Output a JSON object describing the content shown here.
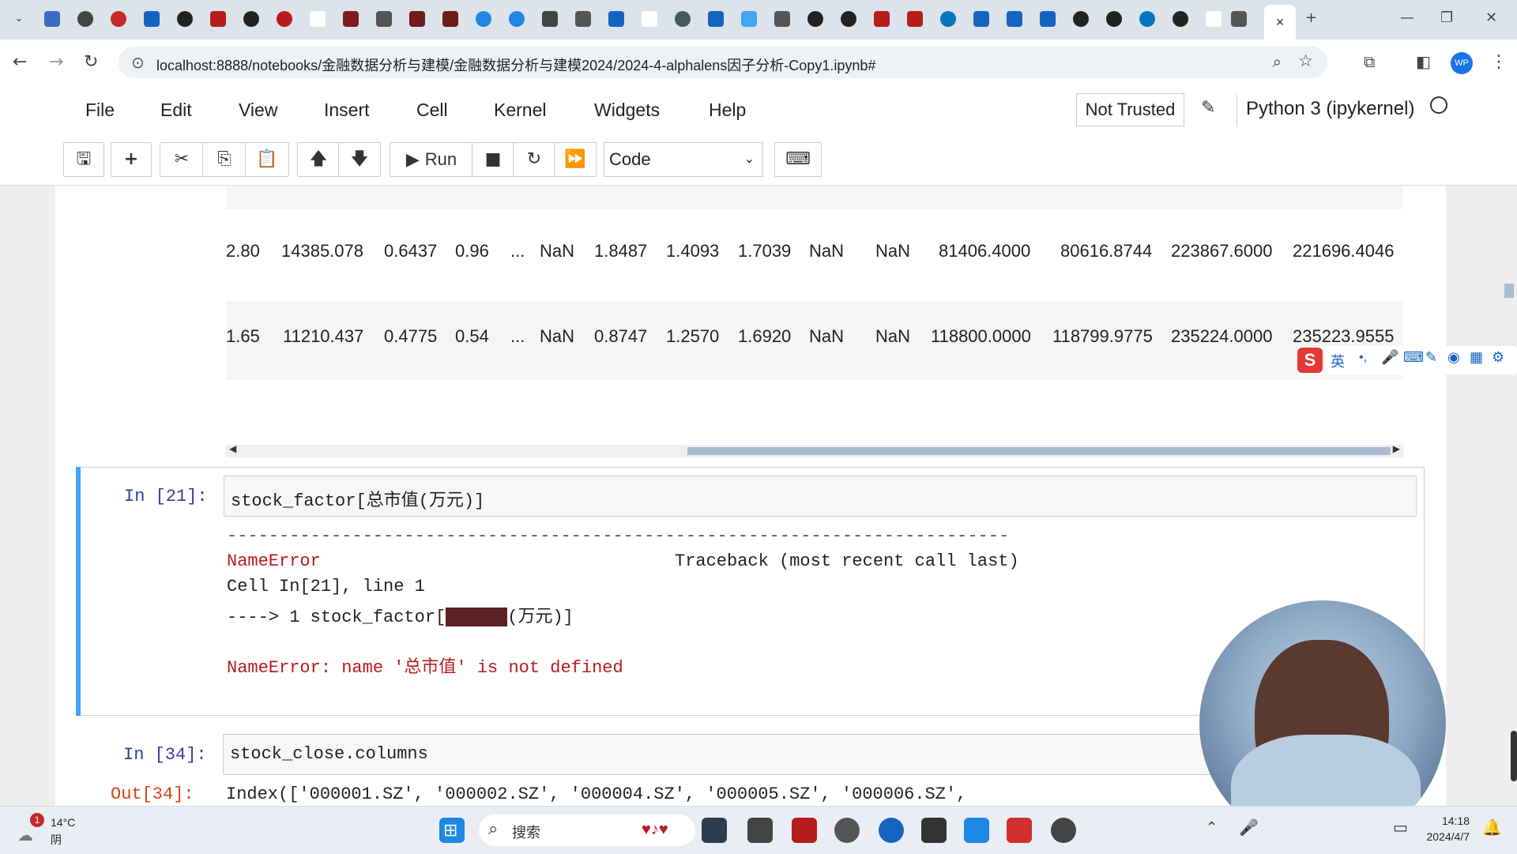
{
  "browser": {
    "url": "localhost:8888/notebooks/金融数据分析与建模/金融数据分析与建模2024/2024-4-alphalens因子分析-Copy1.ipynb#",
    "tab_close": "×",
    "new_tab": "+",
    "profile": "WP"
  },
  "menu": {
    "items": [
      "File",
      "Edit",
      "View",
      "Insert",
      "Cell",
      "Kernel",
      "Widgets",
      "Help"
    ],
    "trust": "Not Trusted",
    "kernel": "Python 3 (ipykernel)"
  },
  "toolbar": {
    "run_label": "Run",
    "cell_type": "Code"
  },
  "dataframe": {
    "rows": [
      [
        "2.80",
        "14385.078",
        "0.6437",
        "0.96",
        "...",
        "NaN",
        "1.8487",
        "1.4093",
        "1.7039",
        "NaN",
        "NaN",
        "81406.4000",
        "80616.8744",
        "223867.6000",
        "221696.4046"
      ],
      [
        "1.65",
        "11210.437",
        "0.4775",
        "0.54",
        "...",
        "NaN",
        "0.8747",
        "1.2570",
        "1.6920",
        "NaN",
        "NaN",
        "118800.0000",
        "118799.9775",
        "235224.0000",
        "235223.9555"
      ]
    ]
  },
  "cell21": {
    "prompt": "In [21]:",
    "code": "stock_factor[总市值(万元)]",
    "dashes": "---------------------------------------------------------------------------",
    "error_name": "NameError",
    "traceback_label": "Traceback (most recent call last)",
    "cell_line": "Cell In[21], line 1",
    "arrow_line_prefix": "----> 1 stock_factor[",
    "arrow_line_suffix": "(万元)]",
    "error_message": "NameError: name '总市值' is not defined"
  },
  "cell34": {
    "prompt": "In [34]:",
    "code": "stock_close.columns",
    "out_prompt": "Out[34]:",
    "output": "Index(['000001.SZ', '000002.SZ', '000004.SZ', '000005.SZ', '000006.SZ',"
  },
  "taskbar": {
    "weather_temp": "14°C",
    "weather_desc": "阴",
    "search_placeholder": "搜索",
    "time": "14:18",
    "date": "2024/4/7",
    "badge": "1"
  },
  "ime": {
    "lang": "英"
  }
}
